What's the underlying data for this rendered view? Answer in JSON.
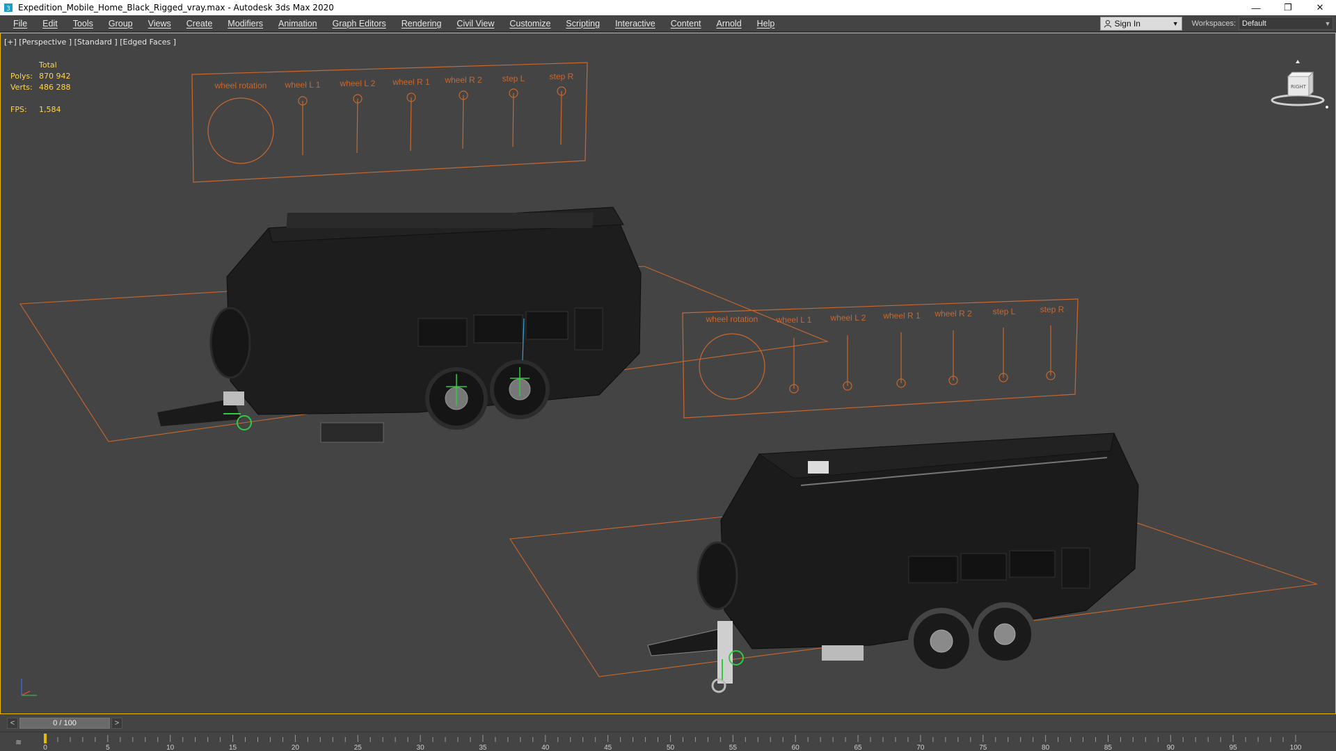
{
  "window": {
    "title": "Expedition_Mobile_Home_Black_Rigged_vray.max - Autodesk 3ds Max 2020",
    "minimize": "—",
    "restore": "❐",
    "close": "✕"
  },
  "menu": [
    "File",
    "Edit",
    "Tools",
    "Group",
    "Views",
    "Create",
    "Modifiers",
    "Animation",
    "Graph Editors",
    "Rendering",
    "Civil View",
    "Customize",
    "Scripting",
    "Interactive",
    "Content",
    "Arnold",
    "Help"
  ],
  "account": {
    "sign_in": "Sign In"
  },
  "workspace": {
    "label": "Workspaces:",
    "value": "Default"
  },
  "viewport": {
    "label": "[+] [Perspective ] [Standard ] [Edged Faces ]",
    "stats": {
      "total_label": "Total",
      "polys_label": "Polys:",
      "polys_value": "870 942",
      "verts_label": "Verts:",
      "verts_value": "486 288",
      "fps_label": "FPS:",
      "fps_value": "1,584"
    },
    "viewcube_label": "RIGHT"
  },
  "controls_panel": {
    "labels": [
      "wheel rotation",
      "wheel L 1",
      "wheel L 2",
      "wheel R 1",
      "wheel R 2",
      "step L",
      "step R"
    ]
  },
  "timeline": {
    "prev": "<",
    "next": ">",
    "frame_display": "0 / 100",
    "current_frame": 0,
    "total_frames": 100,
    "ticks": [
      "0",
      "5",
      "10",
      "15",
      "20",
      "25",
      "30",
      "35",
      "40",
      "45",
      "50",
      "55",
      "60",
      "65",
      "70",
      "75",
      "80",
      "85",
      "90",
      "95",
      "100"
    ]
  },
  "colors": {
    "viewport_bg": "#444444",
    "helper_orange": "#c8682e",
    "stats_yellow": "#ffd54a",
    "active_border": "#e6b800",
    "rig_green": "#2ecc40"
  }
}
